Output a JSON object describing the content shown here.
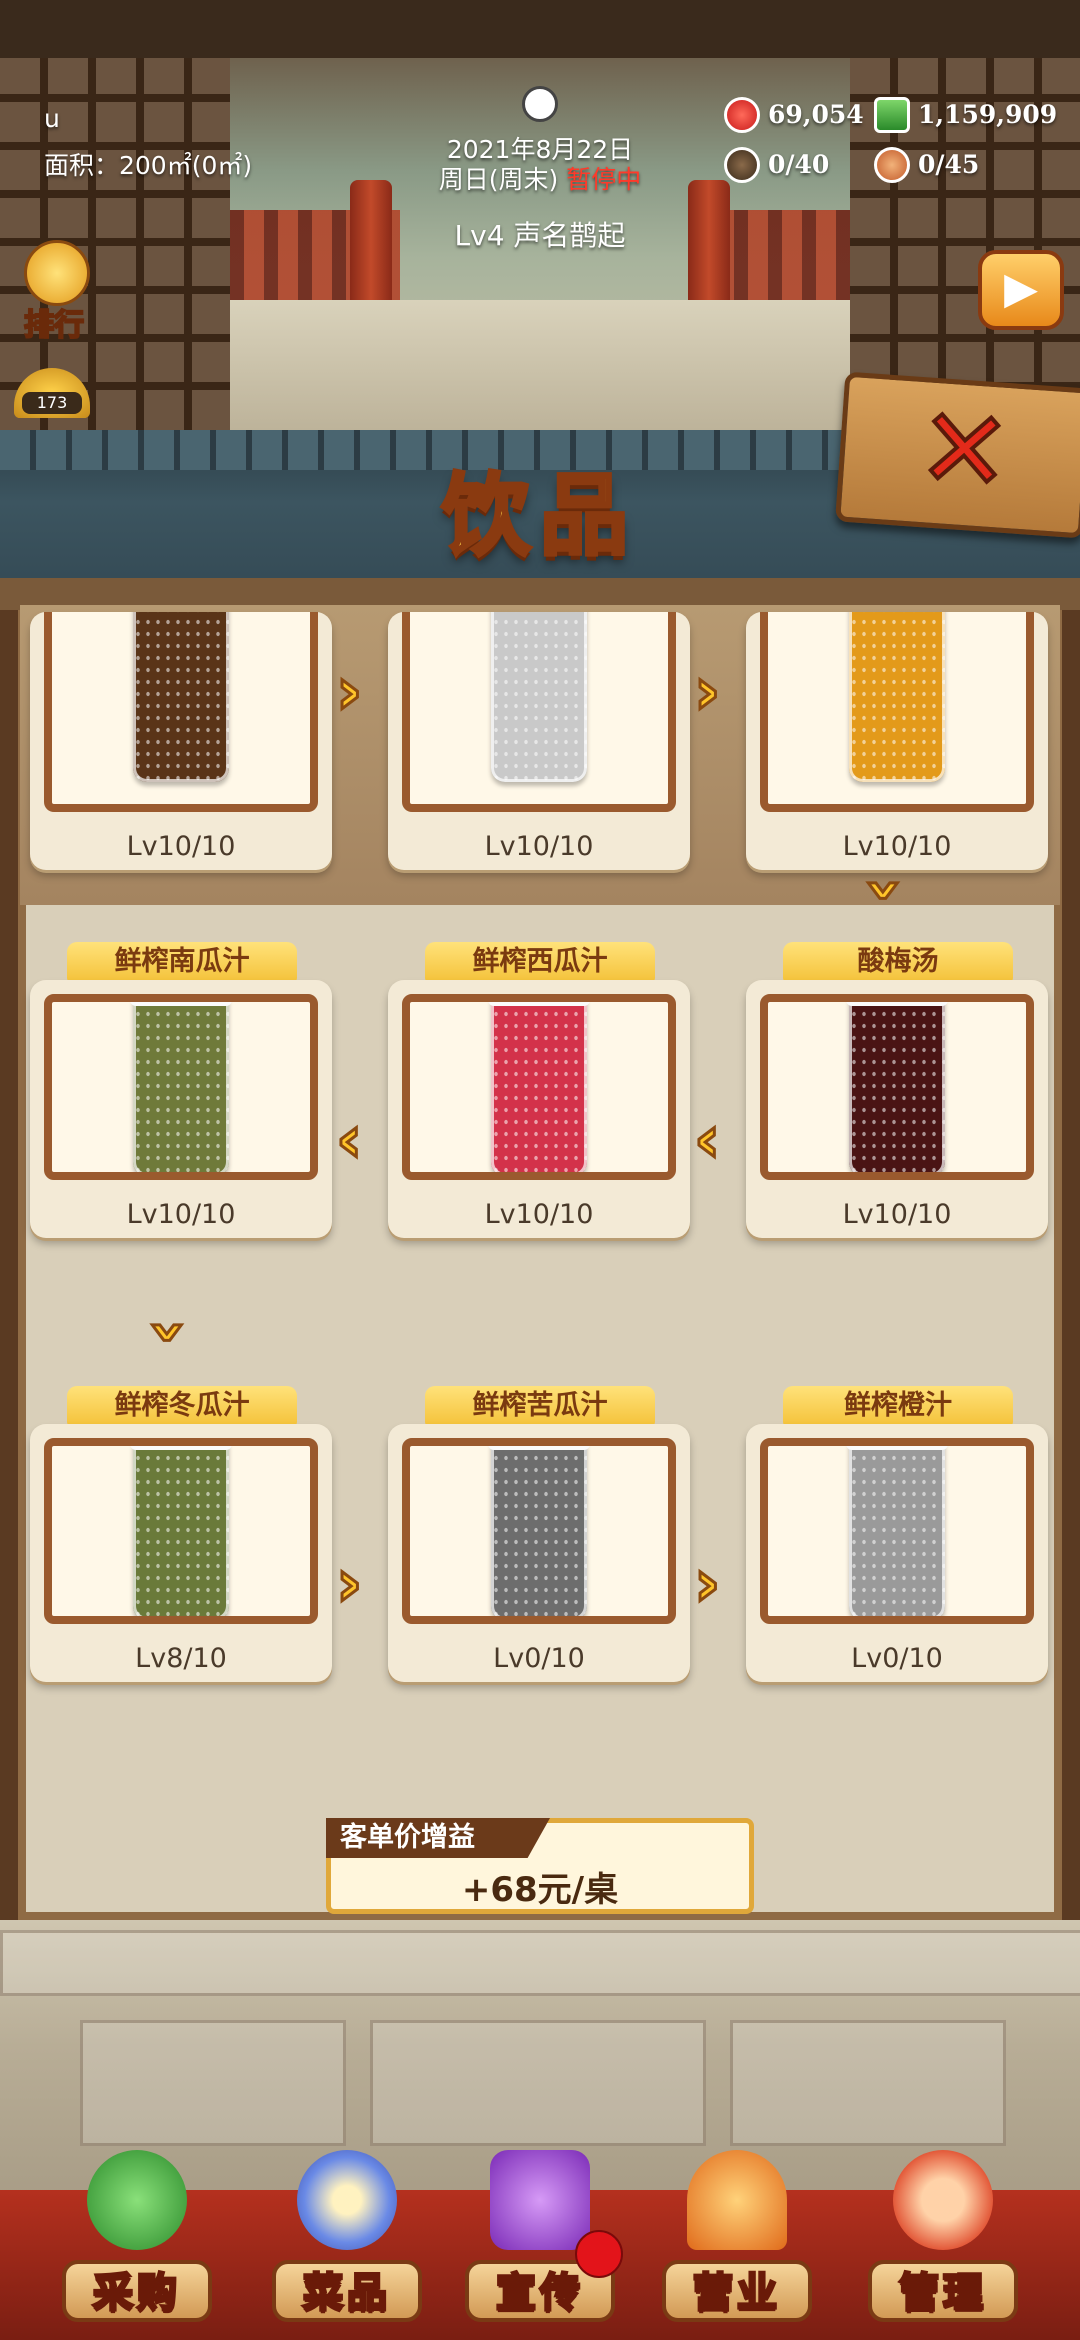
{
  "player": {
    "name": "u",
    "area_label": "面积：200㎡(0㎡)"
  },
  "clock": {
    "date": "2021年8月22日",
    "weekday": "周日(周末)",
    "status": "暂停中"
  },
  "reputation": "Lv4 声名鹊起",
  "resources": {
    "hearts": "69,054",
    "cash": "1,159,909",
    "staff": "0/40",
    "customers": "0/45"
  },
  "ranking_label": "排行",
  "badge_count": "173",
  "panel": {
    "title": "饮品"
  },
  "drinks_partial": [
    {
      "level": "Lv10/10",
      "color": "#5a3418"
    },
    {
      "level": "Lv10/10",
      "color": "#c9c9c9"
    },
    {
      "level": "Lv10/10",
      "color": "#e39a1a"
    }
  ],
  "drinks": [
    {
      "name": "鲜榨南瓜汁",
      "level": "Lv10/10",
      "color": "#6f7a3a"
    },
    {
      "name": "鲜榨西瓜汁",
      "level": "Lv10/10",
      "color": "#d3324a"
    },
    {
      "name": "酸梅汤",
      "level": "Lv10/10",
      "color": "#4a1414"
    },
    {
      "name": "鲜榨冬瓜汁",
      "level": "Lv8/10",
      "color": "#6a7a3a"
    },
    {
      "name": "鲜榨苦瓜汁",
      "level": "Lv0/10",
      "color": "#6d6d6d"
    },
    {
      "name": "鲜榨橙汁",
      "level": "Lv0/10",
      "color": "#9a9a9a"
    }
  ],
  "bonus": {
    "label": "客单价增益",
    "value": "+68元/桌"
  },
  "nav": [
    {
      "label": "采购",
      "icon": "basket-icon",
      "color": "#3aa34a"
    },
    {
      "label": "菜品",
      "icon": "dish-icon",
      "color": "#4b6ad6"
    },
    {
      "label": "宣传",
      "icon": "video-icon",
      "color": "#a04ad6"
    },
    {
      "label": "营业",
      "icon": "bell-icon",
      "color": "#f08a2a"
    },
    {
      "label": "管理",
      "icon": "manager-icon",
      "color": "#e35a3a"
    }
  ]
}
